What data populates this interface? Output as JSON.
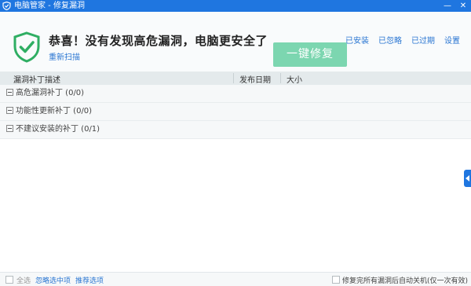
{
  "window": {
    "title": "电脑管家 - 修复漏洞",
    "controls": {
      "min": "—",
      "close": "✕"
    }
  },
  "header": {
    "headline": "恭喜！没有发现高危漏洞，电脑更安全了",
    "rescan": "重新扫描",
    "fix_button": "一键修复",
    "links": [
      "已安装",
      "已忽略",
      "已过期",
      "设置"
    ]
  },
  "columns": [
    "漏洞补丁描述",
    "发布日期",
    "大小"
  ],
  "groups": [
    {
      "label": "高危漏洞补丁 (0/0)"
    },
    {
      "label": "功能性更新补丁 (0/0)"
    },
    {
      "label": "不建议安装的补丁 (0/1)"
    }
  ],
  "footer": {
    "select_all": "全选",
    "ignore_selected": "忽略选中项",
    "recommended": "推荐选项",
    "auto_shutdown": "修复完所有漏洞后自动关机(仅一次有效)"
  },
  "colors": {
    "titlebar": "#1f76e0",
    "accent_green": "#2fae63",
    "fix_button": "#7cd6b0",
    "link": "#2a76d2"
  }
}
